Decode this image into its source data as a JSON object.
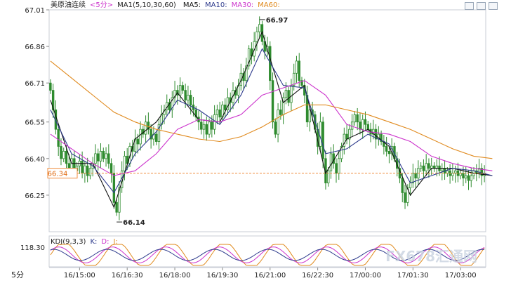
{
  "header": {
    "symbol": "美原油连续",
    "period_tag": "<5分>",
    "ma_label": "MA1(5,10,30,60)",
    "ma5_label": "MA5:",
    "ma10_label": "MA10:",
    "ma30_label": "MA30:",
    "ma60_label": "MA60:"
  },
  "kdj": {
    "label": "KDJ(9,3,3)",
    "k_label": "K:",
    "d_label": "D:",
    "j_label": "J:",
    "value_label": "118.30"
  },
  "period_button": "5分",
  "watermark": "FX678汇通网",
  "colors": {
    "up": "#2e8b2e",
    "down": "#2e8b2e",
    "ma5": "#111111",
    "ma10": "#2d3a8c",
    "ma30": "#cc33cc",
    "ma60": "#e08a1e",
    "current_line": "#f08c3c",
    "k": "#e08a1e",
    "d": "#cc33cc",
    "j": "#2d3a8c"
  },
  "icons": [
    "zoom-in-icon",
    "zoom-out-icon",
    "fullscreen-icon"
  ],
  "chart_data": {
    "type": "candlestick",
    "title": "美原油连续 <5分>",
    "ylim": [
      66.1,
      67.01
    ],
    "y_ticks": [
      "67.01",
      "66.86",
      "66.71",
      "66.55",
      "66.40",
      "66.25"
    ],
    "x_ticks": [
      "16/15:00",
      "16/16:30",
      "16/18:00",
      "16/19:30",
      "16/21:00",
      "16/22:30",
      "17/00:00",
      "17/01:30",
      "17/03:00"
    ],
    "x_tick_positions": [
      11,
      29,
      47,
      65,
      83,
      101,
      119,
      137,
      155
    ],
    "current_price": "66.34",
    "annotations": [
      {
        "text": "66.97",
        "index": 79,
        "value": 66.97,
        "kind": "high"
      },
      {
        "text": "66.14",
        "index": 25,
        "value": 66.14,
        "kind": "low"
      }
    ],
    "candles_close": [
      66.68,
      66.6,
      66.52,
      66.45,
      66.4,
      66.43,
      66.38,
      66.36,
      66.4,
      66.35,
      66.37,
      66.39,
      66.34,
      66.37,
      66.33,
      66.36,
      66.38,
      66.42,
      66.39,
      66.43,
      66.4,
      66.42,
      66.38,
      66.34,
      66.22,
      66.18,
      66.28,
      66.35,
      66.41,
      66.38,
      66.45,
      66.43,
      66.48,
      66.46,
      66.52,
      66.5,
      66.55,
      66.52,
      66.48,
      66.5,
      66.47,
      66.54,
      66.58,
      66.6,
      66.63,
      66.6,
      66.65,
      66.68,
      66.66,
      66.7,
      66.68,
      66.64,
      66.66,
      66.62,
      66.6,
      66.57,
      66.55,
      66.52,
      66.54,
      66.5,
      66.55,
      66.52,
      66.58,
      66.6,
      66.57,
      66.62,
      66.6,
      66.65,
      66.63,
      66.68,
      66.66,
      66.7,
      66.75,
      66.72,
      66.78,
      66.85,
      66.82,
      66.88,
      66.92,
      66.95,
      66.88,
      66.84,
      66.86,
      66.72,
      66.55,
      66.5,
      66.6,
      66.58,
      66.65,
      66.68,
      66.63,
      66.7,
      66.75,
      66.8,
      66.72,
      66.7,
      66.66,
      66.55,
      66.6,
      66.58,
      66.52,
      66.45,
      66.55,
      66.4,
      66.3,
      66.35,
      66.42,
      66.38,
      66.34,
      66.4,
      66.45,
      66.5,
      66.48,
      66.52,
      66.55,
      66.58,
      66.55,
      66.52,
      66.56,
      66.54,
      66.52,
      66.5,
      66.52,
      66.48,
      66.5,
      66.47,
      66.45,
      66.43,
      66.42,
      66.45,
      66.4,
      66.36,
      66.32,
      66.26,
      66.22,
      66.28,
      66.3,
      66.34,
      66.32,
      66.36,
      66.37,
      66.35,
      66.38,
      66.36,
      66.37,
      66.36,
      66.37,
      66.35,
      66.36,
      66.34,
      66.35,
      66.33,
      66.34,
      66.35,
      66.33,
      66.34,
      66.32,
      66.33,
      66.31,
      66.33,
      66.35,
      66.34,
      66.36,
      66.33,
      66.34
    ],
    "series": [
      {
        "name": "MA5",
        "x": [
          0,
          8,
          16,
          24,
          32,
          40,
          48,
          56,
          64,
          72,
          80,
          88,
          96,
          104,
          112,
          120,
          128,
          136,
          144,
          152,
          160,
          167
        ],
        "values": [
          66.64,
          66.38,
          66.38,
          66.2,
          66.48,
          66.55,
          66.67,
          66.56,
          66.55,
          66.72,
          66.92,
          66.63,
          66.7,
          66.34,
          66.48,
          66.52,
          66.45,
          66.25,
          66.36,
          66.36,
          66.34,
          66.33
        ]
      },
      {
        "name": "MA10",
        "x": [
          0,
          8,
          16,
          24,
          32,
          40,
          48,
          56,
          64,
          72,
          80,
          88,
          96,
          104,
          112,
          120,
          128,
          136,
          144,
          152,
          160,
          167
        ],
        "values": [
          66.6,
          66.42,
          66.37,
          66.26,
          66.42,
          66.51,
          66.64,
          66.6,
          66.54,
          66.66,
          66.85,
          66.7,
          66.69,
          66.42,
          66.44,
          66.5,
          66.46,
          66.3,
          66.33,
          66.36,
          66.35,
          66.33
        ]
      },
      {
        "name": "MA30",
        "x": [
          0,
          8,
          16,
          24,
          32,
          40,
          48,
          56,
          64,
          72,
          80,
          88,
          96,
          104,
          112,
          120,
          128,
          136,
          144,
          152,
          160,
          167
        ],
        "values": [
          66.5,
          66.44,
          66.38,
          66.33,
          66.35,
          66.42,
          66.52,
          66.56,
          66.55,
          66.58,
          66.66,
          66.69,
          66.72,
          66.66,
          66.54,
          66.51,
          66.5,
          66.47,
          66.41,
          66.38,
          66.36,
          66.35
        ]
      },
      {
        "name": "MA60",
        "x": [
          0,
          8,
          16,
          24,
          32,
          40,
          48,
          56,
          64,
          72,
          80,
          88,
          96,
          104,
          112,
          120,
          128,
          136,
          144,
          152,
          160,
          167
        ],
        "values": [
          66.8,
          66.73,
          66.66,
          66.59,
          66.55,
          66.52,
          66.5,
          66.48,
          66.47,
          66.49,
          66.53,
          66.58,
          66.62,
          66.62,
          66.6,
          66.58,
          66.55,
          66.52,
          66.48,
          66.44,
          66.41,
          66.4
        ]
      }
    ]
  }
}
